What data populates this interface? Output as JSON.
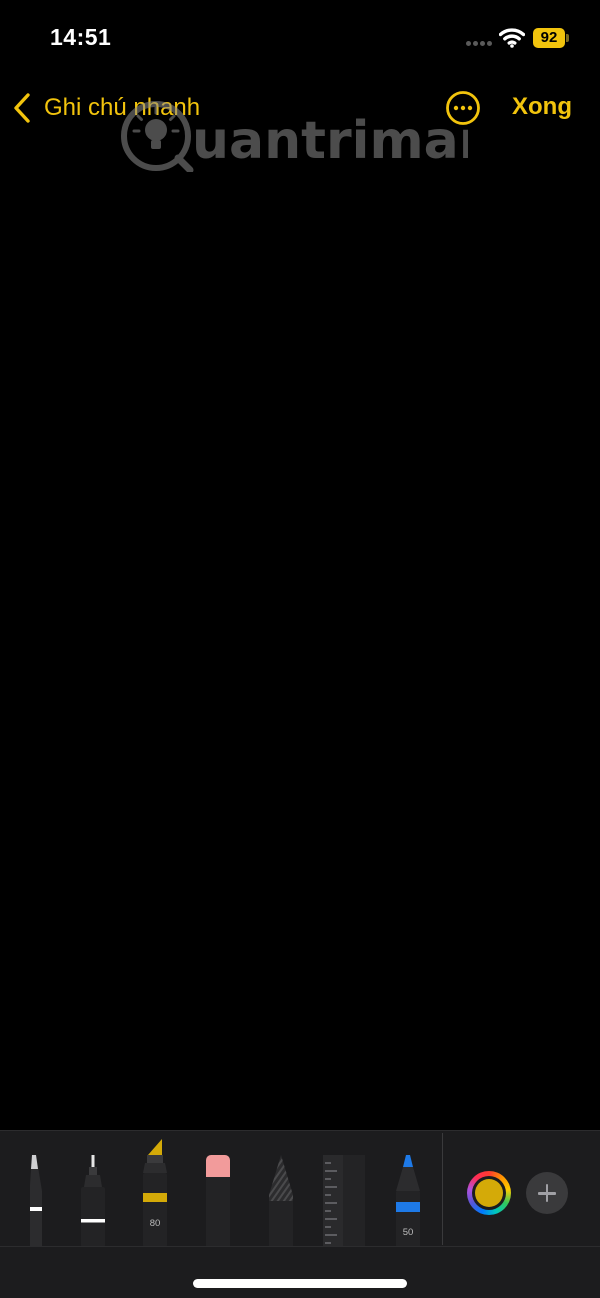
{
  "status_bar": {
    "time": "14:51",
    "battery_level": "92",
    "signal_icon": "cellular-signal-icon",
    "wifi_icon": "wifi-icon",
    "battery_color": "#f2c40d"
  },
  "nav": {
    "back_label": "Ghi chú nhanh",
    "back_icon": "chevron-left-icon",
    "more_icon": "ellipsis-circle-icon",
    "done_label": "Xong",
    "accent_color": "#f2c40d"
  },
  "watermark": {
    "text": "uantrimang",
    "logo_icon": "lightbulb-q-logo"
  },
  "toolbar": {
    "tools": [
      {
        "name": "pen",
        "icon": "pen-tool-icon"
      },
      {
        "name": "monoline",
        "icon": "fineliner-tool-icon"
      },
      {
        "name": "highlighter",
        "icon": "highlighter-tool-icon",
        "label": "80",
        "color": "#d4aa08"
      },
      {
        "name": "eraser",
        "icon": "eraser-tool-icon",
        "color": "#f29b9b"
      },
      {
        "name": "lasso",
        "icon": "lasso-tool-icon"
      },
      {
        "name": "ruler",
        "icon": "ruler-tool-icon"
      },
      {
        "name": "pencil",
        "icon": "pencil-tool-icon",
        "label": "50",
        "color": "#1e7ae8"
      }
    ],
    "selected_color": "#d4aa08",
    "color_picker_icon": "color-wheel-icon",
    "add_icon": "plus-icon"
  }
}
